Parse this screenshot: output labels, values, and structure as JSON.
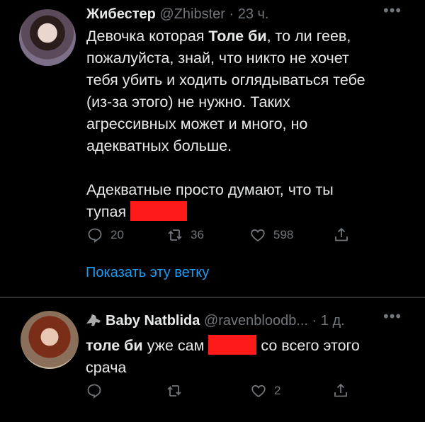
{
  "tweet1": {
    "name": "Жибестер",
    "handle": "@Zhibster",
    "time": "· 23 ч.",
    "more": "•••",
    "lines": [
      {
        "pre": "Девочка которая ",
        "bold": "Толе би",
        "post": ", то ли геев,"
      },
      {
        "pre": "пожалуйста, знай, что никто не хочет"
      },
      {
        "pre": "тебя убить и ходить оглядываться тебе"
      },
      {
        "pre": "(из-за этого) не нужно. Таких"
      },
      {
        "pre": "агрессивных может и много, но"
      },
      {
        "pre": "адекватных больше."
      },
      {
        "pre": ""
      },
      {
        "pre": "Адекватные просто думают, что ты"
      },
      {
        "pre": "тупая "
      }
    ],
    "replies": "20",
    "retweets": "36",
    "likes": "598",
    "show_thread": "Показать эту ветку"
  },
  "tweet2": {
    "name": "Baby Natblida",
    "handle": "@ravenbloodb...",
    "time": "· 1 д.",
    "more": "•••",
    "line1_bold": "толе би",
    "line1_mid": " уже сам ",
    "line1_post": " со всего этого",
    "line2": "срача",
    "replies": "",
    "retweets": "",
    "likes": "2"
  },
  "colors": {
    "background": "#000000",
    "text": "#e7e9ea",
    "muted": "#71767b",
    "link": "#1d9bf0",
    "redaction": "#ff1a1a"
  }
}
